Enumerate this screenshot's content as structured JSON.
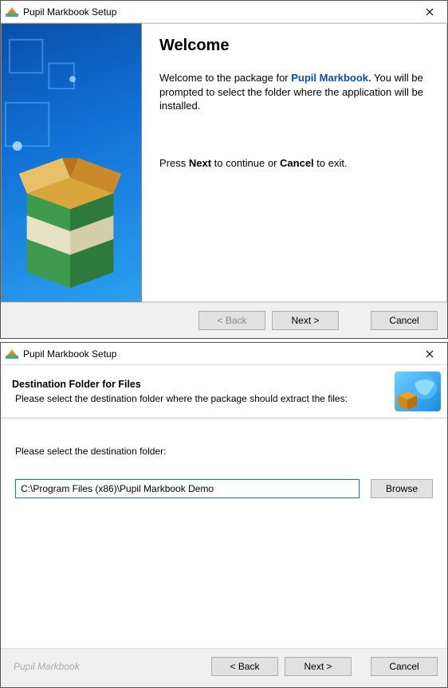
{
  "win1": {
    "title": "Pupil Markbook Setup",
    "welcome_heading": "Welcome",
    "intro_pre": "Welcome to the package for ",
    "intro_brand": "Pupil Markbook.",
    "intro_post": " You will be prompted to select the folder where the application will be installed.",
    "press_pre": "Press ",
    "press_next": "Next",
    "press_mid": " to continue or ",
    "press_cancel": "Cancel",
    "press_post": " to exit.",
    "buttons": {
      "back": "< Back",
      "next": "Next >",
      "cancel": "Cancel"
    }
  },
  "win2": {
    "title": "Pupil Markbook Setup",
    "header_title": "Destination Folder for Files",
    "header_sub": "Please select the destination folder where the package should extract the files:",
    "dest_label": "Please select the destination folder:",
    "path_value": "C:\\Program Files (x86)\\Pupil Markbook Demo",
    "browse": "Browse",
    "footer_brand": "Pupil Markbook",
    "buttons": {
      "back": "< Back",
      "next": "Next >",
      "cancel": "Cancel"
    }
  }
}
